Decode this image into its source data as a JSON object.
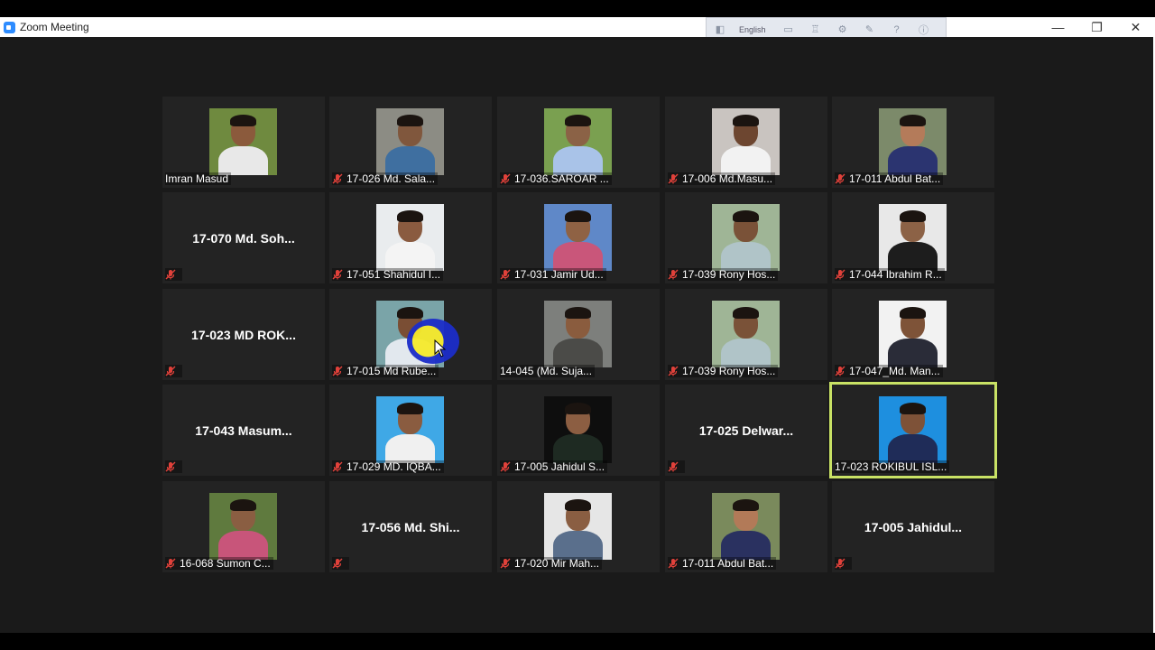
{
  "window": {
    "title": "Zoom Meeting",
    "ime_language": "English",
    "minimize": "—",
    "restore": "❐",
    "close": "✕"
  },
  "participants": [
    {
      "name": "Imran Masud",
      "video": true,
      "muted": false,
      "bg": "#6f8a3f",
      "shirt": "#e8e8e8",
      "skin": "#8b5a3c"
    },
    {
      "name": "17-026 Md. Sala...",
      "video": true,
      "muted": true,
      "bg": "#8c8c84",
      "shirt": "#3f6fa0",
      "skin": "#80573d"
    },
    {
      "name": "17-036.SAROAR ...",
      "video": true,
      "muted": true,
      "bg": "#7aa050",
      "shirt": "#a9c3e8",
      "skin": "#8b6246"
    },
    {
      "name": "17-006 Md.Masu...",
      "video": true,
      "muted": true,
      "bg": "#c9c4c0",
      "shirt": "#f2f2f2",
      "skin": "#6d4630"
    },
    {
      "name": "17-011 Abdul Bat...",
      "video": true,
      "muted": true,
      "bg": "#7c8a6a",
      "shirt": "#2b3470",
      "skin": "#b47b5a"
    },
    {
      "name": "17-070 Md. Soh...",
      "video": false,
      "muted": true
    },
    {
      "name": "17-051 Shahidul I...",
      "video": true,
      "muted": true,
      "bg": "#e9ecee",
      "shirt": "#f4f4f4",
      "skin": "#8a5b40"
    },
    {
      "name": "17-031 Jamir Ud...",
      "video": true,
      "muted": true,
      "bg": "#5f88c8",
      "shirt": "#c9567a",
      "skin": "#8f6244"
    },
    {
      "name": "17-039 Rony Hos...",
      "video": true,
      "muted": true,
      "bg": "#9fb596",
      "shirt": "#b0c4c8",
      "skin": "#7a5238"
    },
    {
      "name": "17-044 Ibrahim R...",
      "video": true,
      "muted": true,
      "bg": "#e8e8e8",
      "shirt": "#1d1d1d",
      "skin": "#8c6246"
    },
    {
      "name": "17-023 MD ROK...",
      "video": false,
      "muted": true
    },
    {
      "name": "17-015 Md Rube...",
      "video": true,
      "muted": true,
      "bg": "#7aa4a8",
      "shirt": "#e2e8ee",
      "skin": "#7a4e34"
    },
    {
      "name": "14-045 (Md. Suja...",
      "video": true,
      "muted": false,
      "bg": "#7d7f7c",
      "shirt": "#4b4b48",
      "skin": "#8a5c3e"
    },
    {
      "name": "17-039 Rony Hos...",
      "video": true,
      "muted": true,
      "bg": "#9fb596",
      "shirt": "#b0c4c8",
      "skin": "#7a5238"
    },
    {
      "name": "17-047_Md. Man...",
      "video": true,
      "muted": true,
      "bg": "#f2f2f2",
      "shirt": "#2a2c38",
      "skin": "#7e5338"
    },
    {
      "name": "17-043 Masum...",
      "video": false,
      "muted": true
    },
    {
      "name": "17-029 MD. IQBA...",
      "video": true,
      "muted": true,
      "bg": "#3fa8e6",
      "shirt": "#f0f0f0",
      "skin": "#8a5c40"
    },
    {
      "name": "17-005 Jahidul S...",
      "video": true,
      "muted": true,
      "bg": "#0e0e0e",
      "shirt": "#1e2a22",
      "skin": "#8c5e42"
    },
    {
      "name": "17-025 Delwar...",
      "video": false,
      "muted": true
    },
    {
      "name": "17-023 ROKIBUL ISL...",
      "video": true,
      "muted": false,
      "active": true,
      "bg": "#1e8fdf",
      "shirt": "#1f2c58",
      "skin": "#7e5238"
    },
    {
      "name": "16-068 Sumon C...",
      "video": true,
      "muted": true,
      "bg": "#5f7a3e",
      "shirt": "#c8557a",
      "skin": "#8a5e42"
    },
    {
      "name": "17-056 Md. Shi...",
      "video": false,
      "muted": true
    },
    {
      "name": "17-020 Mir Mah...",
      "video": true,
      "muted": true,
      "bg": "#e6e6e6",
      "shirt": "#5a6f8c",
      "skin": "#8a5e42"
    },
    {
      "name": "17-011 Abdul Bat...",
      "video": true,
      "muted": true,
      "bg": "#7a8a5c",
      "shirt": "#2a3160",
      "skin": "#b27a58"
    },
    {
      "name": "17-005 Jahidul...",
      "video": false,
      "muted": true
    }
  ]
}
